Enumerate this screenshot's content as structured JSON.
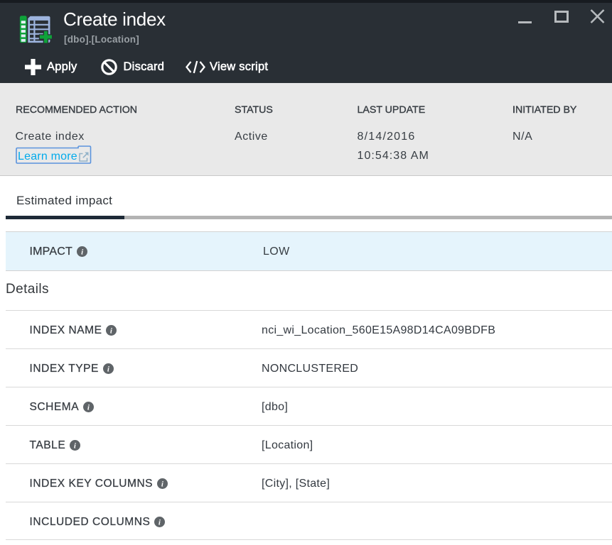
{
  "header": {
    "title": "Create index",
    "subtitle": "[dbo].[Location]"
  },
  "window_controls": {
    "minimize": "minimize",
    "maximize": "maximize",
    "close": "close"
  },
  "toolbar": {
    "apply_label": "Apply",
    "discard_label": "Discard",
    "view_script_label": "View script"
  },
  "summary": {
    "columns": [
      {
        "header": "RECOMMENDED ACTION",
        "value": "Create index",
        "link": "Learn more"
      },
      {
        "header": "STATUS",
        "value": "Active"
      },
      {
        "header": "LAST UPDATE",
        "value": "8/14/2016",
        "value2": "10:54:38 AM"
      },
      {
        "header": "INITIATED BY",
        "value": "N/A"
      }
    ]
  },
  "tabs": {
    "active": "Estimated impact"
  },
  "impact": {
    "label": "IMPACT",
    "value": "LOW"
  },
  "details": {
    "heading": "Details",
    "rows": [
      {
        "label": "INDEX NAME",
        "value": "nci_wi_Location_560E15A98D14CA09BDFB"
      },
      {
        "label": "INDEX TYPE",
        "value": "NONCLUSTERED"
      },
      {
        "label": "SCHEMA",
        "value": "[dbo]"
      },
      {
        "label": "TABLE",
        "value": "[Location]"
      },
      {
        "label": "INDEX KEY COLUMNS",
        "value": "[City], [State]"
      },
      {
        "label": "INCLUDED COLUMNS",
        "value": ""
      }
    ]
  },
  "colors": {
    "header_bg": "#292f35",
    "link": "#00abec",
    "focus_ring": "#4f8fe0",
    "impact_row_bg": "#e5f4fc",
    "icon_green": "#0fa23a",
    "icon_blue": "#9db4de"
  }
}
